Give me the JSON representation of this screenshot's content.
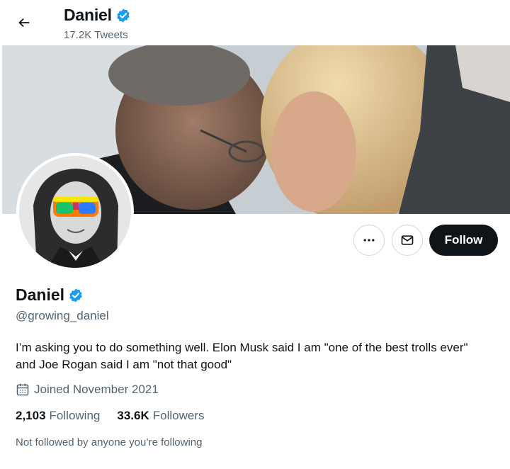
{
  "header": {
    "name": "Daniel",
    "tweet_count": "17.2K Tweets"
  },
  "actions": {
    "more_icon": "ellipsis-icon",
    "message_icon": "envelope-icon",
    "follow_label": "Follow"
  },
  "profile": {
    "name": "Daniel",
    "handle": "@growing_daniel",
    "bio_line1": "I’m asking you to do something well. Elon Musk said I am \"one of the best trolls ever\"",
    "bio_line2": "and Joe Rogan said I am \"not that good\"",
    "joined": "Joined November 2021",
    "following_count": "2,103",
    "following_label": "Following",
    "followers_count": "33.6K",
    "followers_label": "Followers",
    "not_followed_text": "Not followed by anyone you’re following"
  },
  "colors": {
    "verified": "#1d9bf0",
    "text": "#0f1419",
    "secondary": "#536471",
    "follow_bg": "#0f1419"
  }
}
